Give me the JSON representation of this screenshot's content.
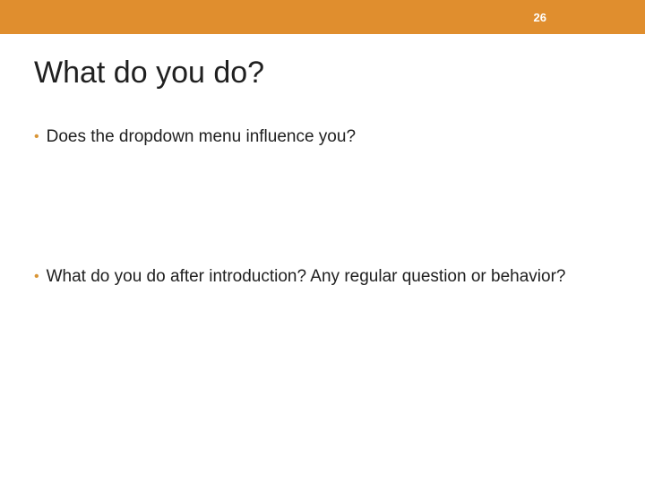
{
  "header": {
    "page_number": "26"
  },
  "title": "What do you do?",
  "bullets": [
    {
      "text": "Does the dropdown menu influence you?"
    },
    {
      "text": "What do you do after introduction? Any regular question or behavior?"
    }
  ],
  "colors": {
    "accent": "#e08e2e",
    "bullet": "#d99536",
    "text": "#202020"
  }
}
